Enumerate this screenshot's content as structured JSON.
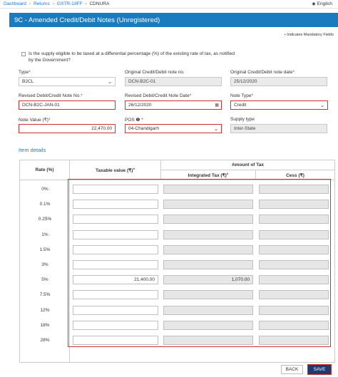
{
  "breadcrumb": [
    {
      "label": "Dashboard"
    },
    {
      "label": "Returns"
    },
    {
      "label": "GSTR-1/IFF"
    },
    {
      "label": "CDNURA"
    }
  ],
  "language": "English",
  "header": {
    "title": "9C - Amended Credit/Debit Notes (Unregistered)"
  },
  "mandatory_note": "Indicates Mandatory Fields",
  "differential_checkbox": {
    "label": "Is the supply eligible to be taxed at a differential percentage (%) of the existing rate of tax, as notified by the Government?",
    "checked": false
  },
  "fields": {
    "type": {
      "label": "Type",
      "value": "B2CL"
    },
    "original_note_no": {
      "label": "Original Credit/Debit note no.",
      "value": "DCN-B2C-01"
    },
    "original_note_date": {
      "label": "Original Credit/Debit note date",
      "value": "25/12/2020"
    },
    "revised_note_no": {
      "label": "Revised Debit/Credit Note No.",
      "value": "DCN-B2C-JAN-01"
    },
    "revised_note_date": {
      "label": "Revised Debit/Credit Note Date",
      "value": "26/12/2020"
    },
    "note_type": {
      "label": "Note Type",
      "value": "Credit"
    },
    "note_value": {
      "label": "Note Value (₹)",
      "value": "22,470.00"
    },
    "pos": {
      "label": "POS",
      "value": "04-Chandigarh"
    },
    "supply_type": {
      "label": "Supply type",
      "value": "Inter-State"
    }
  },
  "item_details": {
    "title": "Item details",
    "headers": {
      "rate": "Rate (%)",
      "taxable_value": "Taxable value (₹)",
      "amount_of_tax": "Amount of Tax",
      "integrated_tax": "Integrated Tax (₹)",
      "cess": "Cess (₹)"
    },
    "rows": [
      {
        "rate": "0%",
        "taxable": "",
        "igst": "",
        "cess": ""
      },
      {
        "rate": "0.1%",
        "taxable": "",
        "igst": "",
        "cess": ""
      },
      {
        "rate": "0.25%",
        "taxable": "",
        "igst": "",
        "cess": ""
      },
      {
        "rate": "1%",
        "taxable": "",
        "igst": "",
        "cess": ""
      },
      {
        "rate": "1.5%",
        "taxable": "",
        "igst": "",
        "cess": ""
      },
      {
        "rate": "3%",
        "taxable": "",
        "igst": "",
        "cess": ""
      },
      {
        "rate": "5%",
        "taxable": "21,400.00",
        "igst": "1,070.00",
        "cess": ""
      },
      {
        "rate": "7.5%",
        "taxable": "",
        "igst": "",
        "cess": ""
      },
      {
        "rate": "12%",
        "taxable": "",
        "igst": "",
        "cess": ""
      },
      {
        "rate": "18%",
        "taxable": "",
        "igst": "",
        "cess": ""
      },
      {
        "rate": "28%",
        "taxable": "",
        "igst": "",
        "cess": ""
      }
    ]
  },
  "buttons": {
    "back": "BACK",
    "save": "SAVE"
  },
  "colors": {
    "header_bg": "#1a7bbf",
    "link": "#1a73e8",
    "required": "#c62828",
    "highlight": "#d32f2f",
    "save_bg": "#1f3a6e"
  }
}
